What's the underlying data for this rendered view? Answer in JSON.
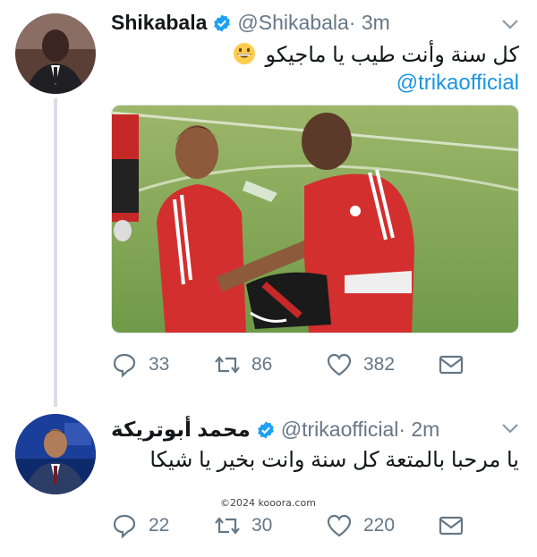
{
  "tweet1": {
    "name": "Shikabala",
    "handle": "@Shikabala",
    "time": " · 3m",
    "text": "كل سنة وأنت طيب يا ماجيكو",
    "emoji": "grinning-face-emoji",
    "mention": "@trikaofficial",
    "replies": "33",
    "retweets": "86",
    "likes": "382"
  },
  "tweet2": {
    "name": "محمد أبوتريكة",
    "handle": "@trikaofficial",
    "time": " · 2m",
    "text": "يا مرحبا بالمتعة كل سنة وانت بخير يا شيكا",
    "replies": "22",
    "retweets": "30",
    "likes": "220"
  },
  "watermark": "©2024 kooora.com",
  "colors": {
    "verified": "#1da1f2",
    "muted": "#657786",
    "link": "#1b95e0"
  }
}
